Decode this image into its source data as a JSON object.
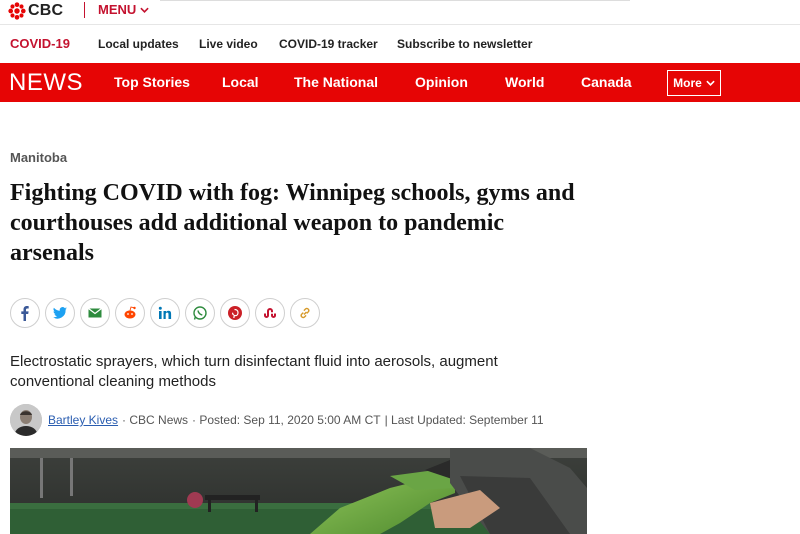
{
  "topbar": {
    "logo_text": "CBC",
    "menu_label": "MENU",
    "brand_color": "#c4122f"
  },
  "covid_bar": {
    "label": "COVID-19",
    "links": [
      "Local updates",
      "Live video",
      "COVID-19 tracker",
      "Subscribe to newsletter"
    ]
  },
  "news_nav": {
    "logo": "NEWS",
    "items": [
      "Top Stories",
      "Local",
      "The National",
      "Opinion",
      "World",
      "Canada"
    ],
    "more_label": "More",
    "bg_color": "#e60505"
  },
  "article": {
    "section": "Manitoba",
    "headline": "Fighting COVID with fog: Winnipeg schools, gyms and courthouses add additional weapon to pandemic arsenals",
    "deck": "Electrostatic sprayers, which turn disinfectant fluid into aerosols, augment conventional cleaning methods",
    "share_icons": [
      "facebook-icon",
      "twitter-icon",
      "email-icon",
      "reddit-icon",
      "linkedin-icon",
      "whatsapp-icon",
      "pinterest-icon",
      "stumbleupon-icon",
      "link-icon"
    ],
    "byline": {
      "author": "Bartley Kives",
      "source": "· CBC News",
      "posted": "· Posted: Sep 11, 2020 5:00 AM CT",
      "updated": "| Last Updated: September 11"
    }
  }
}
